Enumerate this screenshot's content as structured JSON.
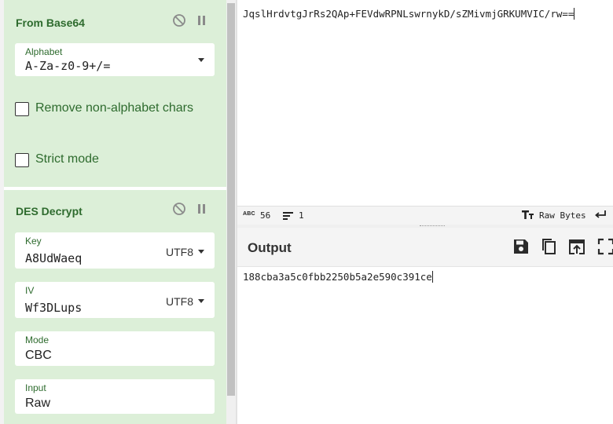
{
  "recipe": {
    "from_base64": {
      "title": "From Base64",
      "alphabet_label": "Alphabet",
      "alphabet_value": "A-Za-z0-9+/=",
      "remove_non_alphabet_label": "Remove non-alphabet chars",
      "strict_mode_label": "Strict mode"
    },
    "des_decrypt": {
      "title": "DES Decrypt",
      "key_label": "Key",
      "key_value": "A8UdWaeq",
      "key_encoding": "UTF8",
      "iv_label": "IV",
      "iv_value": "Wf3DLups",
      "iv_encoding": "UTF8",
      "mode_label": "Mode",
      "mode_value": "CBC",
      "input_label": "Input",
      "input_value": "Raw"
    }
  },
  "input": {
    "text": "JqslHrdvtgJrRs2QAp+FEVdwRPNLswrnykD/sZMivmjGRKUMVIC/rw=="
  },
  "statusbar": {
    "abc_label": "ABC",
    "length": "56",
    "lines": "1",
    "raw_bytes_label": "Raw Bytes"
  },
  "output": {
    "title": "Output",
    "text": "188cba3a5c0fbb2250b5a2e590c391ce"
  },
  "colors": {
    "op_background": "#dcefd8",
    "op_title": "#2e6b2e"
  }
}
